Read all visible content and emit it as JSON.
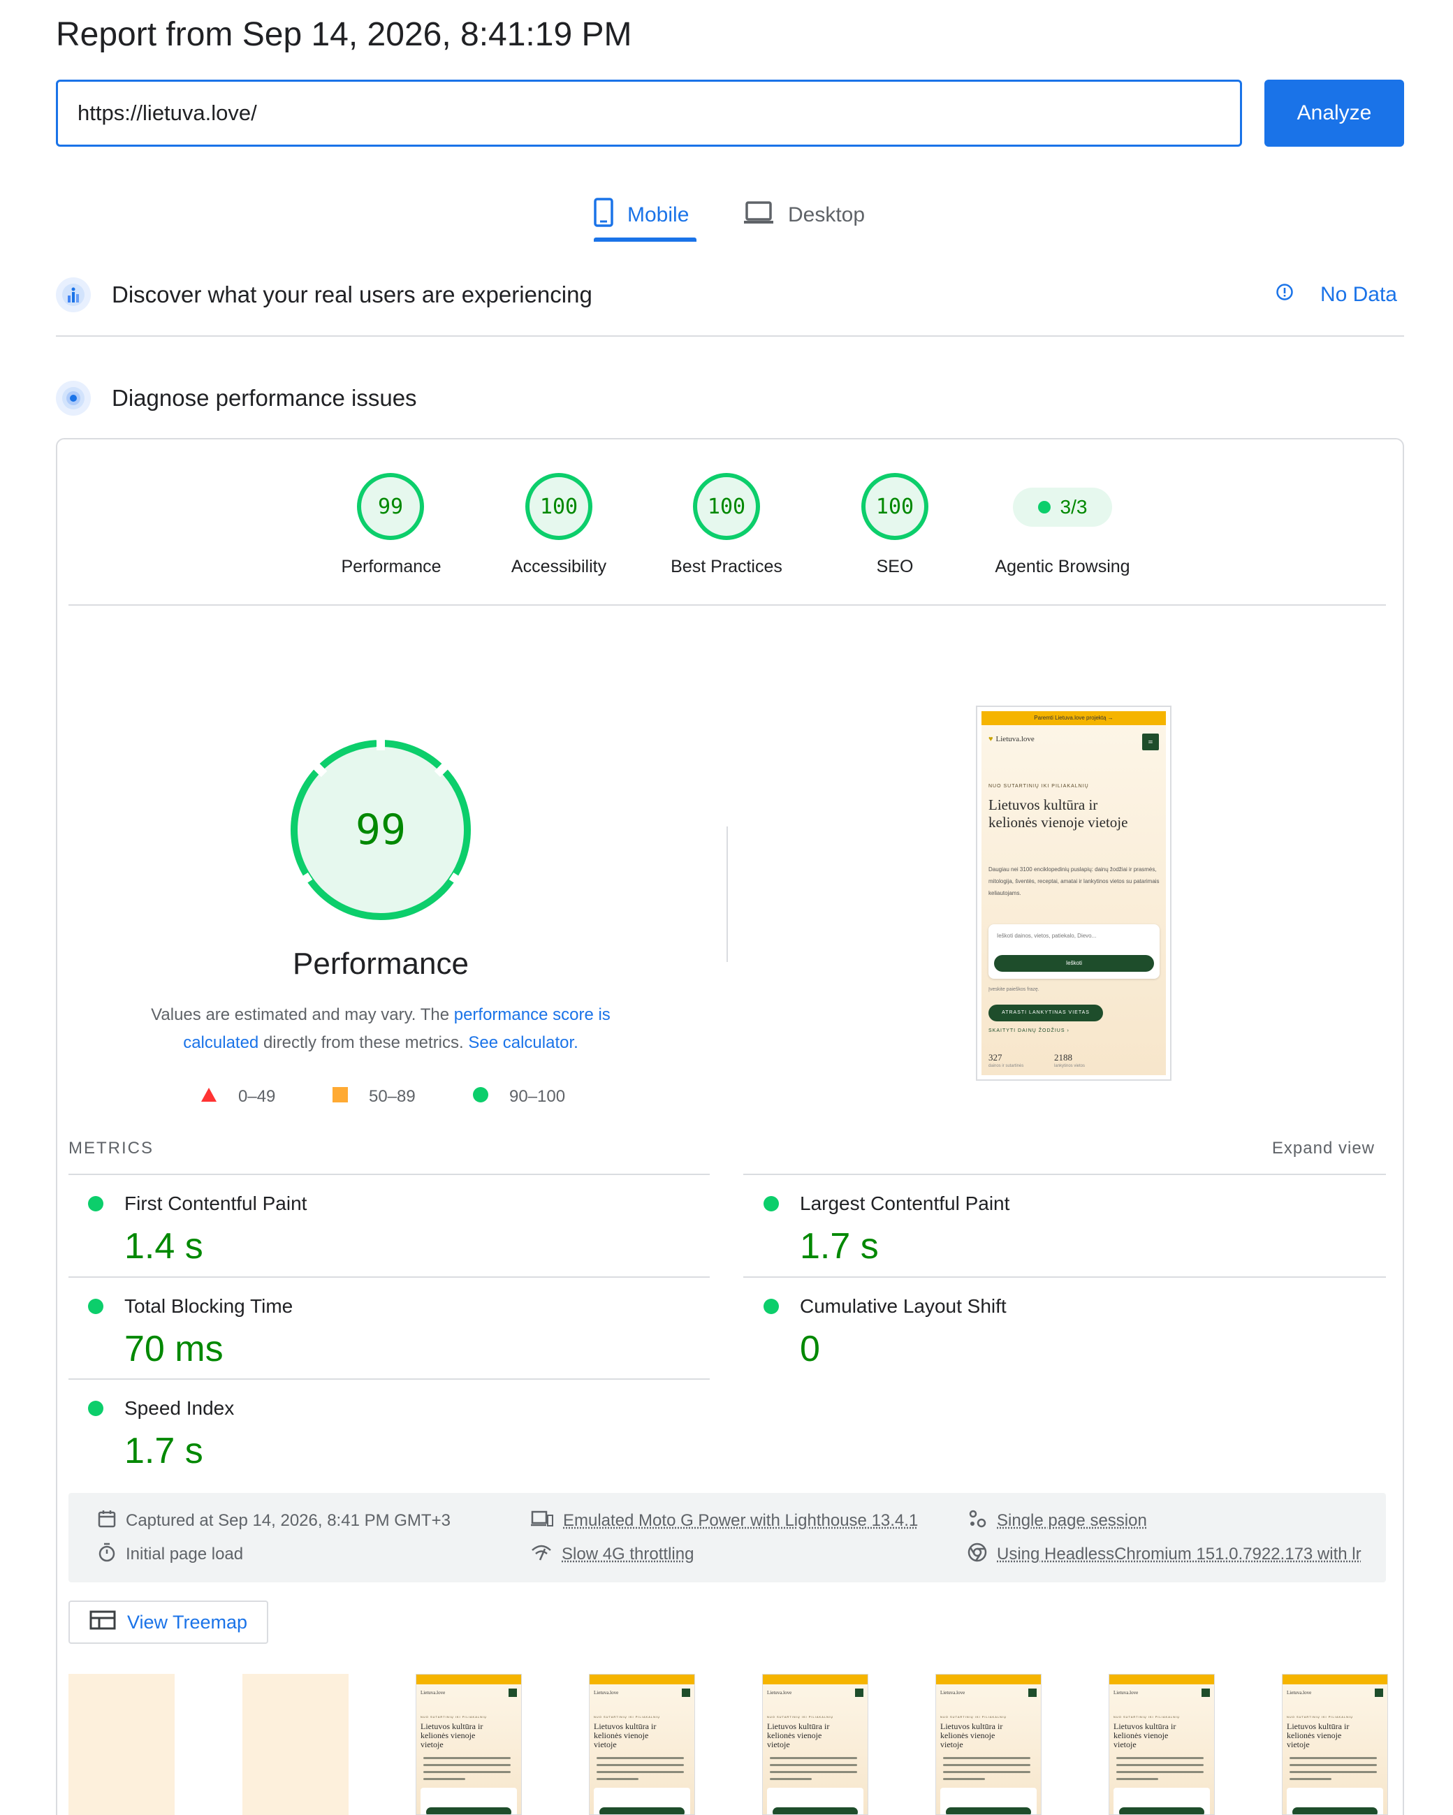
{
  "header": {
    "title": "Report from Sep 14, 2026, 8:41:19 PM",
    "url_value": "https://lietuva.love/",
    "analyze_label": "Analyze"
  },
  "tabs": [
    {
      "label": "Mobile",
      "icon": "phone-icon",
      "selected": true
    },
    {
      "label": "Desktop",
      "icon": "laptop-icon",
      "selected": false
    }
  ],
  "field_data": {
    "title": "Discover what your real users are experiencing",
    "status": "No Data"
  },
  "diagnose": {
    "title": "Diagnose performance issues"
  },
  "categories": [
    {
      "score": "99",
      "label": "Performance"
    },
    {
      "score": "100",
      "label": "Accessibility"
    },
    {
      "score": "100",
      "label": "Best Practices"
    },
    {
      "score": "100",
      "label": "SEO"
    }
  ],
  "agentic": {
    "score": "3/3",
    "label": "Agentic Browsing"
  },
  "performance": {
    "score": "99",
    "score_fraction": 0.99,
    "label": "Performance",
    "explain_prefix": "Values are estimated and may vary. The ",
    "explain_link1": "performance score is calculated",
    "explain_mid": " directly from these metrics. ",
    "explain_link2": "See calculator."
  },
  "legend": [
    {
      "range": "0–49",
      "shape": "triangle",
      "color": "#ff3333"
    },
    {
      "range": "50–89",
      "shape": "square",
      "color": "#ffaa33"
    },
    {
      "range": "90–100",
      "shape": "circle",
      "color": "#0cce6b"
    }
  ],
  "screenshot": {
    "banner": "Paremti Lietuva.love projektą →",
    "logo": "Lietuva.love",
    "eyebrow": "NUO SUTARTINIŲ IKI PILIAKALNIŲ",
    "heading": "Lietuvos kultūra ir kelionės vienoje vietoje",
    "body": "Daugiau nei 3100 enciklopedinių puslapių: dainų žodžiai ir prasmės, mitologija, šventės, receptai, amatai ir lankytinos vietos su patarimais keliautojams.",
    "search_placeholder": "Ieškoti dainos, vietos, patiekalo, Dievo...",
    "search_button": "Ieškoti",
    "hint": "Įveskite paieškos frazę.",
    "cta": "ATRASTI LANKYTINAS VIETAS",
    "link": "SKAITYTI DAINŲ ŽODŽIUS ›",
    "stat1_value": "327",
    "stat1_label": "dainos ir sutartinės",
    "stat2_value": "2188",
    "stat2_label": "lankytinos vietos"
  },
  "metrics": {
    "title": "METRICS",
    "expand": "Expand view",
    "items": [
      {
        "name": "First Contentful Paint",
        "value": "1.4 s"
      },
      {
        "name": "Largest Contentful Paint",
        "value": "1.7 s"
      },
      {
        "name": "Total Blocking Time",
        "value": "70 ms"
      },
      {
        "name": "Cumulative Layout Shift",
        "value": "0"
      },
      {
        "name": "Speed Index",
        "value": "1.7 s"
      }
    ]
  },
  "runtime": {
    "captured": "Captured at Sep 14, 2026, 8:41 PM GMT+3",
    "initial": "Initial page load",
    "emulated": "Emulated Moto G Power with Lighthouse 13.4.1",
    "throttling": "Slow 4G throttling",
    "session": "Single page session",
    "browser": "Using HeadlessChromium 151.0.7922.173 with lr"
  },
  "treemap_label": "View Treemap",
  "filmstrip": {
    "frames": [
      "blank",
      "blank",
      "page",
      "page",
      "page",
      "page",
      "page",
      "page"
    ],
    "logo": "Lietuva.love",
    "heading": "Lietuvos kultūra ir kelionės vienoje vietoje",
    "eyebrow": "NUO SUTARTINIŲ IKI PILIAKALNIŲ"
  },
  "colors": {
    "accent": "#1a73e8",
    "good": "#0cce6b",
    "good_text": "#008800",
    "good_bg": "#e6f8ee"
  }
}
